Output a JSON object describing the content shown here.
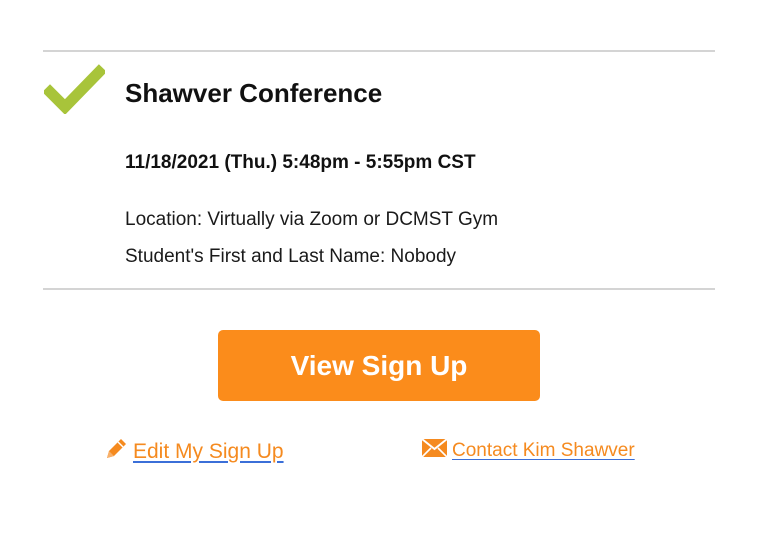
{
  "event": {
    "title": "Shawver Conference",
    "datetime": "11/18/2021 (Thu.) 5:48pm - 5:55pm CST",
    "location": "Location: Virtually via Zoom or DCMST Gym",
    "student": "Student's First and Last Name: Nobody",
    "status_icon": "checkmark-icon"
  },
  "actions": {
    "view_label": "View Sign Up",
    "edit_label": "Edit My Sign Up",
    "edit_icon": "pencil-icon",
    "contact_label": "Contact Kim Shawver",
    "contact_icon": "mail-icon"
  },
  "colors": {
    "accent_orange": "#fb8c1b",
    "link_orange": "#f58a1f",
    "check_green": "#a8c43a",
    "divider_gray": "#d4d4d4",
    "underline_blue": "#3b6fd8"
  }
}
